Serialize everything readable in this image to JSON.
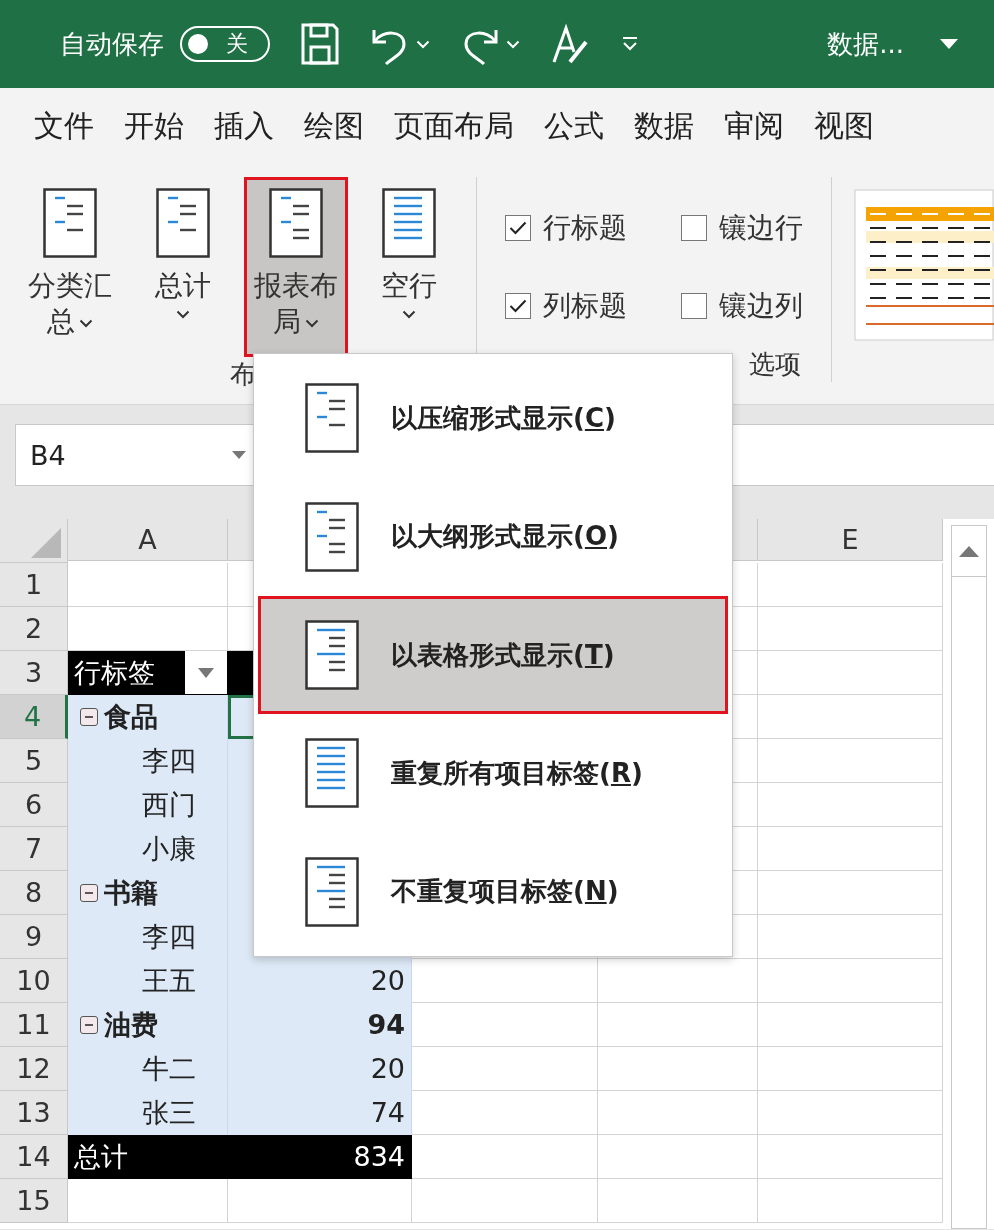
{
  "title_bar": {
    "autosave": {
      "label": "自动保存",
      "on": false,
      "state_text": "关"
    },
    "file_name": "数据..."
  },
  "tabs": [
    {
      "label": "文件"
    },
    {
      "label": "开始"
    },
    {
      "label": "插入"
    },
    {
      "label": "绘图"
    },
    {
      "label": "页面布局"
    },
    {
      "label": "公式"
    },
    {
      "label": "数据"
    },
    {
      "label": "审阅"
    },
    {
      "label": "视图"
    }
  ],
  "ribbon": {
    "layout_group": {
      "label": "布",
      "buttons": [
        {
          "label": "分类汇总",
          "selected": false,
          "highlighted": false
        },
        {
          "label": "总计",
          "selected": false,
          "highlighted": false
        },
        {
          "label": "报表布局",
          "selected": true,
          "highlighted": true
        },
        {
          "label": "空行",
          "selected": false,
          "highlighted": false
        }
      ]
    },
    "options_group": {
      "label": "选项",
      "options": [
        {
          "label": "行标题",
          "checked": true
        },
        {
          "label": "镶边行",
          "checked": false
        },
        {
          "label": "列标题",
          "checked": true
        },
        {
          "label": "镶边列",
          "checked": false
        }
      ]
    }
  },
  "name_box": {
    "value": "B4"
  },
  "sheet": {
    "columns": [
      "A",
      "E"
    ],
    "rows": [
      {
        "number": "1",
        "selected": false,
        "kind": "empty"
      },
      {
        "number": "2",
        "selected": false,
        "kind": "empty"
      },
      {
        "number": "3",
        "selected": false,
        "kind": "header",
        "label": "行标签"
      },
      {
        "number": "4",
        "selected": true,
        "kind": "group",
        "label": "食品",
        "expanded": true
      },
      {
        "number": "5",
        "selected": false,
        "kind": "item",
        "label": "李四"
      },
      {
        "number": "6",
        "selected": false,
        "kind": "item",
        "label": "西门"
      },
      {
        "number": "7",
        "selected": false,
        "kind": "item",
        "label": "小康"
      },
      {
        "number": "8",
        "selected": false,
        "kind": "group",
        "label": "书籍",
        "expanded": true
      },
      {
        "number": "9",
        "selected": false,
        "kind": "item",
        "label": "李四"
      },
      {
        "number": "10",
        "selected": false,
        "kind": "item",
        "label": "王五",
        "value": "20"
      },
      {
        "number": "11",
        "selected": false,
        "kind": "group",
        "label": "油费",
        "expanded": true,
        "value": "94"
      },
      {
        "number": "12",
        "selected": false,
        "kind": "item",
        "label": "牛二",
        "value": "20"
      },
      {
        "number": "13",
        "selected": false,
        "kind": "item",
        "label": "张三",
        "value": "74"
      },
      {
        "number": "14",
        "selected": false,
        "kind": "total",
        "label": "总计",
        "value": "834"
      },
      {
        "number": "15",
        "selected": false,
        "kind": "empty"
      }
    ]
  },
  "report_layout_menu": {
    "items": [
      {
        "label": "以压缩形式显示(C)",
        "selected": false,
        "highlighted": false
      },
      {
        "label": "以大纲形式显示(O)",
        "selected": false,
        "highlighted": false
      },
      {
        "label": "以表格形式显示(T)",
        "selected": true,
        "highlighted": true
      },
      {
        "label": "重复所有项目标签(R)",
        "selected": false,
        "highlighted": false
      },
      {
        "label": "不重复项目标签(N)",
        "selected": false,
        "highlighted": false
      }
    ]
  }
}
